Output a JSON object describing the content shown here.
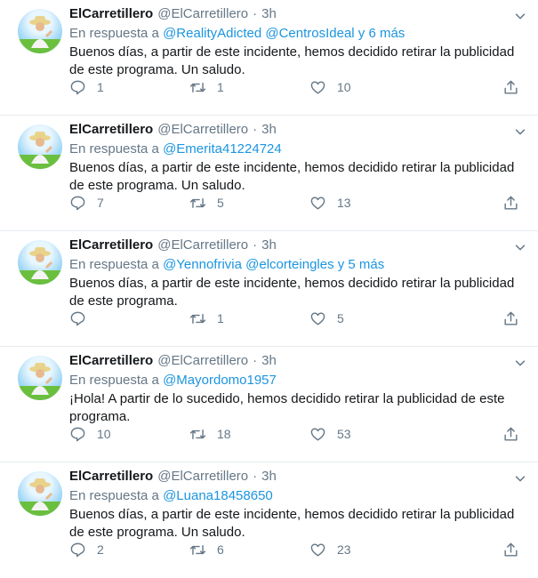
{
  "tweets": [
    {
      "name": "ElCarretillero",
      "handle": "@ElCarretillero",
      "dot": "·",
      "time": "3h",
      "reply_prefix": "En respuesta a",
      "reply_to": "@RealityAdicted @CentrosIdeal y 6 más",
      "text": "Buenos días, a partir de este incidente, hemos decidido retirar la publicidad de este programa. Un saludo.",
      "replies": "1",
      "retweets": "1",
      "likes": "10"
    },
    {
      "name": "ElCarretillero",
      "handle": "@ElCarretillero",
      "dot": "·",
      "time": "3h",
      "reply_prefix": "En respuesta a",
      "reply_to": "@Emerita41224724",
      "text": "Buenos días, a partir de este incidente, hemos decidido retirar la publicidad de este programa. Un saludo.",
      "replies": "7",
      "retweets": "5",
      "likes": "13"
    },
    {
      "name": "ElCarretillero",
      "handle": "@ElCarretillero",
      "dot": "·",
      "time": "3h",
      "reply_prefix": "En respuesta a",
      "reply_to": "@Yennofrivia @elcorteingles y 5 más",
      "text": "Buenos días, a partir de este incidente, hemos decidido retirar la publicidad de este programa.",
      "replies": "",
      "retweets": "1",
      "likes": "5"
    },
    {
      "name": "ElCarretillero",
      "handle": "@ElCarretillero",
      "dot": "·",
      "time": "3h",
      "reply_prefix": "En respuesta a",
      "reply_to": "@Mayordomo1957",
      "text": "¡Hola! A partir de lo sucedido, hemos decidido retirar la publicidad de este programa.",
      "replies": "10",
      "retweets": "18",
      "likes": "53"
    },
    {
      "name": "ElCarretillero",
      "handle": "@ElCarretillero",
      "dot": "·",
      "time": "3h",
      "reply_prefix": "En respuesta a",
      "reply_to": "@Luana18458650",
      "text": "Buenos días, a partir de este incidente, hemos decidido retirar la publicidad de este programa. Un saludo.",
      "replies": "2",
      "retweets": "6",
      "likes": "23"
    }
  ],
  "icons": {
    "reply": "reply-icon",
    "retweet": "retweet-icon",
    "like": "heart-icon",
    "share": "share-icon",
    "menu": "chevron-down-icon"
  },
  "colors": {
    "link": "#1b95e0",
    "muted": "#657786",
    "text": "#14171a",
    "divider": "#e6ecf0"
  }
}
